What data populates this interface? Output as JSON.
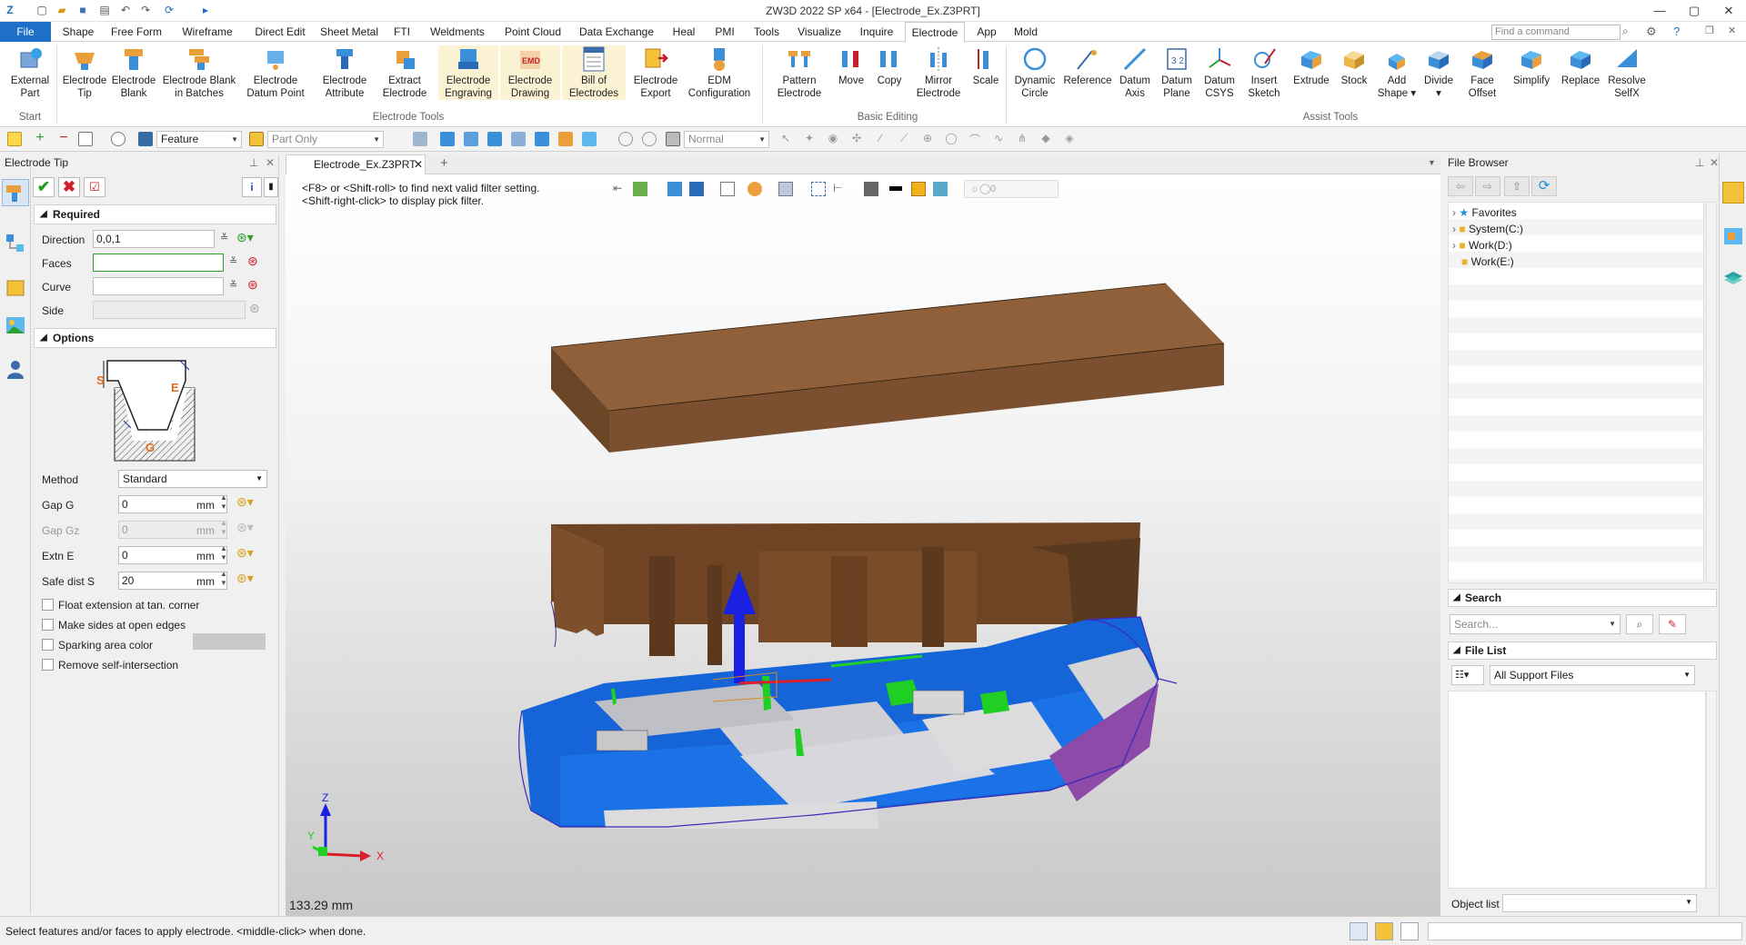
{
  "window": {
    "title": "ZW3D 2022 SP x64 - [Electrode_Ex.Z3PRT]"
  },
  "menu": {
    "tabs": [
      "File",
      "Shape",
      "Free Form",
      "Wireframe",
      "Direct Edit",
      "Sheet Metal",
      "FTI",
      "Weldments",
      "Point Cloud",
      "Data Exchange",
      "Heal",
      "PMI",
      "Tools",
      "Visualize",
      "Inquire",
      "Electrode",
      "App",
      "Mold"
    ],
    "active": "Electrode",
    "search_placeholder": "Find a command"
  },
  "ribbon": {
    "buttons": [
      {
        "label1": "External",
        "label2": "Part"
      },
      {
        "label1": "Electrode",
        "label2": "Tip"
      },
      {
        "label1": "Electrode",
        "label2": "Blank"
      },
      {
        "label1": "Electrode Blank",
        "label2": "in Batches"
      },
      {
        "label1": "Electrode",
        "label2": "Datum Point"
      },
      {
        "label1": "Electrode",
        "label2": "Attribute"
      },
      {
        "label1": "Extract",
        "label2": "Electrode"
      },
      {
        "label1": "Electrode",
        "label2": "Engraving"
      },
      {
        "label1": "Electrode",
        "label2": "Drawing"
      },
      {
        "label1": "Bill of",
        "label2": "Electrodes"
      },
      {
        "label1": "Electrode",
        "label2": "Export"
      },
      {
        "label1": "EDM",
        "label2": "Configuration"
      },
      {
        "label1": "Pattern",
        "label2": "Electrode"
      },
      {
        "label1": "Move",
        "label2": ""
      },
      {
        "label1": "Copy",
        "label2": ""
      },
      {
        "label1": "Mirror",
        "label2": "Electrode"
      },
      {
        "label1": "Scale",
        "label2": ""
      },
      {
        "label1": "Dynamic",
        "label2": "Circle"
      },
      {
        "label1": "Reference",
        "label2": ""
      },
      {
        "label1": "Datum",
        "label2": "Axis"
      },
      {
        "label1": "Datum",
        "label2": "Plane"
      },
      {
        "label1": "Datum",
        "label2": "CSYS"
      },
      {
        "label1": "Insert",
        "label2": "Sketch"
      },
      {
        "label1": "Extrude",
        "label2": ""
      },
      {
        "label1": "Stock",
        "label2": ""
      },
      {
        "label1": "Add",
        "label2": "Shape ▾"
      },
      {
        "label1": "Divide",
        "label2": "▾"
      },
      {
        "label1": "Face",
        "label2": "Offset"
      },
      {
        "label1": "Simplify",
        "label2": ""
      },
      {
        "label1": "Replace",
        "label2": ""
      },
      {
        "label1": "Resolve",
        "label2": "SelfX"
      }
    ],
    "groups": {
      "start": "Start",
      "electrode_tools": "Electrode Tools",
      "basic_editing": "Basic Editing",
      "assist_tools": "Assist Tools"
    }
  },
  "toolbar": {
    "filter": "Feature",
    "scope": "Part Only",
    "render": "Normal"
  },
  "left_panel": {
    "title": "Electrode Tip",
    "required": {
      "header": "Required",
      "direction_label": "Direction",
      "direction_value": "0,0,1",
      "faces_label": "Faces",
      "faces_value": "",
      "curve_label": "Curve",
      "curve_value": "",
      "side_label": "Side",
      "side_value": ""
    },
    "options": {
      "header": "Options",
      "diagram_labels": {
        "s": "S",
        "e": "E",
        "g": "G"
      },
      "method_label": "Method",
      "method_value": "Standard",
      "gap_g_label": "Gap G",
      "gap_g_value": "0",
      "gap_gz_label": "Gap Gz",
      "gap_gz_value": "0",
      "extn_e_label": "Extn E",
      "extn_e_value": "0",
      "safe_dist_label": "Safe dist S",
      "safe_dist_value": "20",
      "unit": "mm",
      "float_ext": "Float extension at tan. corner",
      "make_sides": "Make sides at open edges",
      "sparking": "Sparking area color",
      "remove_self": "Remove self-intersection"
    }
  },
  "viewport": {
    "doc_tab": "Electrode_Ex.Z3PRT",
    "hint1": "<F8> or <Shift-roll> to find next valid filter setting.",
    "hint2": "<Shift-right-click> to display pick filter.",
    "scale_readout": "133.29 mm",
    "counter": "0",
    "axis": {
      "x": "X",
      "y": "Y",
      "z": "Z"
    }
  },
  "right_panel": {
    "title": "File Browser",
    "tree": [
      "Favorites",
      "System(C:)",
      "Work(D:)",
      "Work(E:)"
    ],
    "search_header": "Search",
    "search_placeholder": "Search...",
    "file_list_header": "File List",
    "file_filter": "All Support Files",
    "object_list_label": "Object list"
  },
  "status": {
    "message": "Select features and/or faces to apply electrode.  <middle-click> when done."
  },
  "colors": {
    "accent": "#1e6fc8",
    "electrode_brown": "#8a5a36",
    "part_blue": "#1565d8",
    "highlight_green": "#1fcf24"
  }
}
